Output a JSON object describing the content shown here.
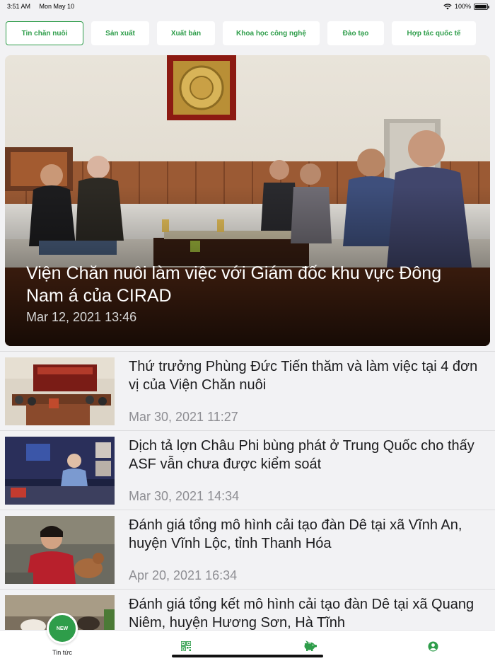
{
  "status": {
    "time": "3:51 AM",
    "date": "Mon May 10",
    "battery": "100%"
  },
  "tabs": [
    {
      "label": "Tin chăn nuôi",
      "active": true
    },
    {
      "label": "Sản xuất",
      "active": false
    },
    {
      "label": "Xuất bản",
      "active": false
    },
    {
      "label": "Khoa học công nghệ",
      "active": false
    },
    {
      "label": "Đào tạo",
      "active": false
    },
    {
      "label": "Hợp tác quốc tế",
      "active": false
    }
  ],
  "hero": {
    "title": "Viện Chăn nuôi làm việc với Giám đốc khu vực Đông Nam á của CIRAD",
    "date": "Mar 12, 2021 13:46"
  },
  "articles": [
    {
      "title": "Thứ trưởng Phùng Đức Tiến thăm và làm việc tại 4 đơn vị của Viện Chăn nuôi",
      "date": "Mar 30, 2021 11:27"
    },
    {
      "title": "Dịch tả lợn Châu Phi bùng phát ở Trung Quốc cho thấy ASF vẫn chưa được kiểm soát",
      "date": "Mar 30, 2021 14:34"
    },
    {
      "title": "Đánh giá tổng mô hình cải tạo đàn Dê tại xã Vĩnh An, huyện Vĩnh Lộc, tỉnh Thanh Hóa",
      "date": "Apr 20, 2021 16:34"
    },
    {
      "title": "Đánh giá tổng kết mô hình cải tạo đàn Dê tại xã Quang Niêm, huyện Hương Sơn, Hà Tĩnh",
      "date": ""
    }
  ],
  "bottom_nav": {
    "fab_label": "NEW",
    "news_label": "Tin tức",
    "icons": [
      "news-icon",
      "qr-code-icon",
      "piggy-bank-icon",
      "account-icon"
    ]
  },
  "colors": {
    "accent": "#2e9d4a",
    "background": "#f2f2f4"
  }
}
